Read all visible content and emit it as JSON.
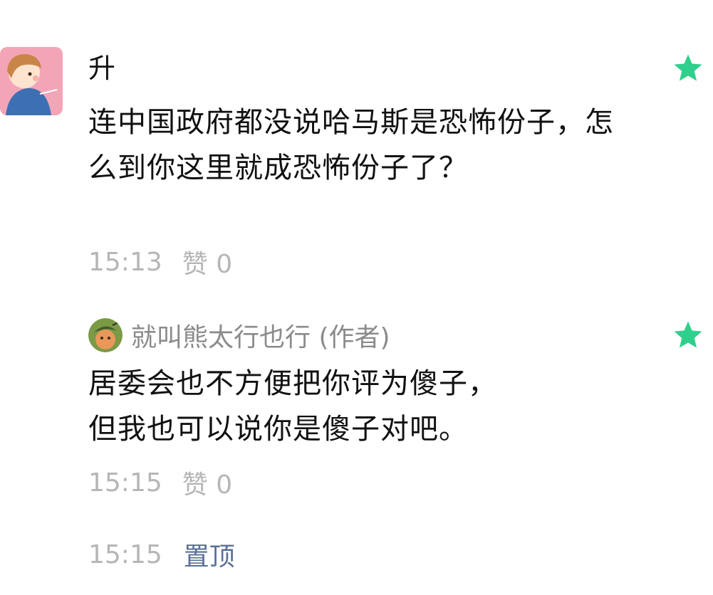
{
  "comment": {
    "avatar_icon": "cartoon-child-avatar",
    "nickname": "升",
    "text": "连中国政府都没说哈马斯是恐怖份子，怎么到你这里就成恐怖份子了？",
    "time": "15:13",
    "likes": "赞 0",
    "star_icon": "star-icon",
    "star_color": "#2fcf8c"
  },
  "reply": {
    "avatar_icon": "cartoon-avatar",
    "name": "就叫熊太行也行 (作者)",
    "text_line1": "居委会也不方便把你评为傻子，",
    "text_line2": "但我也可以说你是傻子对吧。",
    "time": "15:15",
    "likes": "赞 0",
    "star_icon": "star-icon"
  },
  "footer": {
    "time": "15:15",
    "pin_label": "置顶",
    "pin_color": "#5a6f95"
  },
  "colors": {
    "primary_text": "#111111",
    "secondary_text": "#b6b6b6",
    "name_text": "#8b8b8b"
  }
}
